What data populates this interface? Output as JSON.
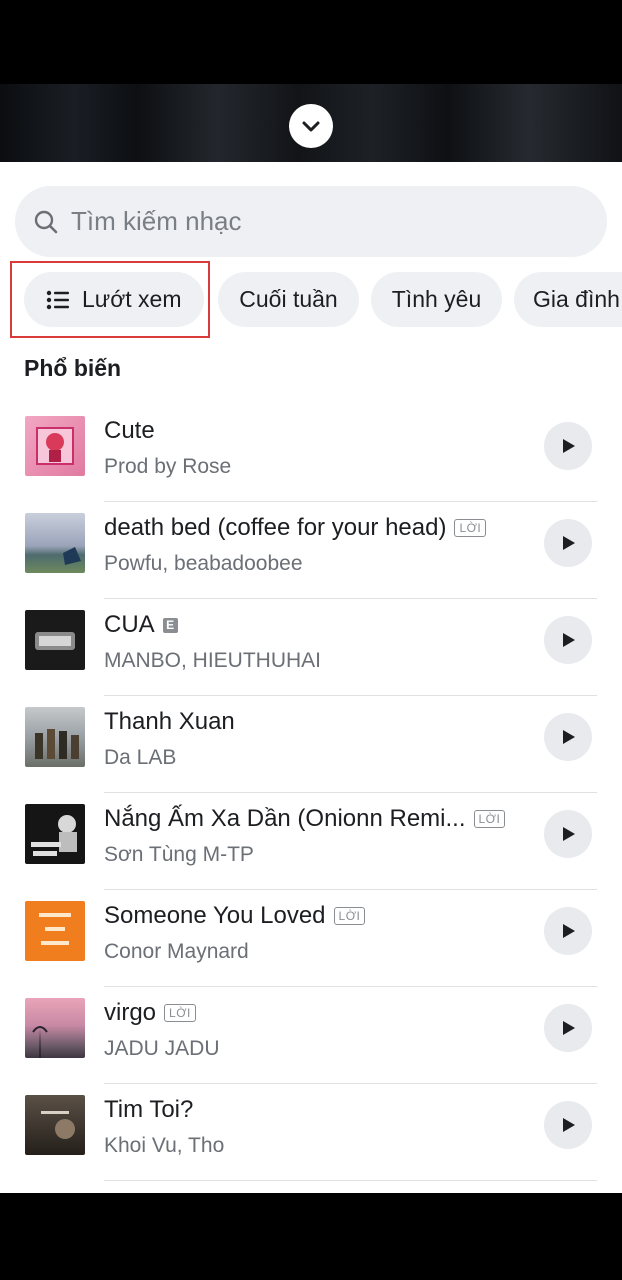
{
  "header": {
    "collapse_icon": "chevron-down-icon"
  },
  "search": {
    "placeholder": "Tìm kiếm nhạc",
    "icon": "search-icon"
  },
  "chips": [
    {
      "label": "Lướt xem",
      "icon": "list-icon"
    },
    {
      "label": "Cuối tuần"
    },
    {
      "label": "Tình yêu"
    },
    {
      "label": "Gia đình"
    }
  ],
  "section": {
    "title": "Phổ biến"
  },
  "songs": [
    {
      "title": "Cute",
      "artist": "Prod by Rose",
      "badge": ""
    },
    {
      "title": "death bed (coffee for your head)",
      "artist": "Powfu, beabadoobee",
      "badge": "LỜI"
    },
    {
      "title": "CUA",
      "artist": "MANBO, HIEUTHUHAI",
      "badge": "E"
    },
    {
      "title": "Thanh Xuan",
      "artist": "Da LAB",
      "badge": ""
    },
    {
      "title": "Nắng Ấm Xa Dần (Onionn Remi...",
      "artist": "Sơn Tùng M-TP",
      "badge": "LỜI"
    },
    {
      "title": "Someone You Loved",
      "artist": "Conor Maynard",
      "badge": "LỜI"
    },
    {
      "title": "virgo",
      "artist": "JADU JADU",
      "badge": "LỜI"
    },
    {
      "title": "Tim Toi?",
      "artist": "Khoi Vu, Tho",
      "badge": ""
    }
  ],
  "colors": {
    "highlight": "#d93a3a",
    "chip_bg": "#eef0f3"
  }
}
